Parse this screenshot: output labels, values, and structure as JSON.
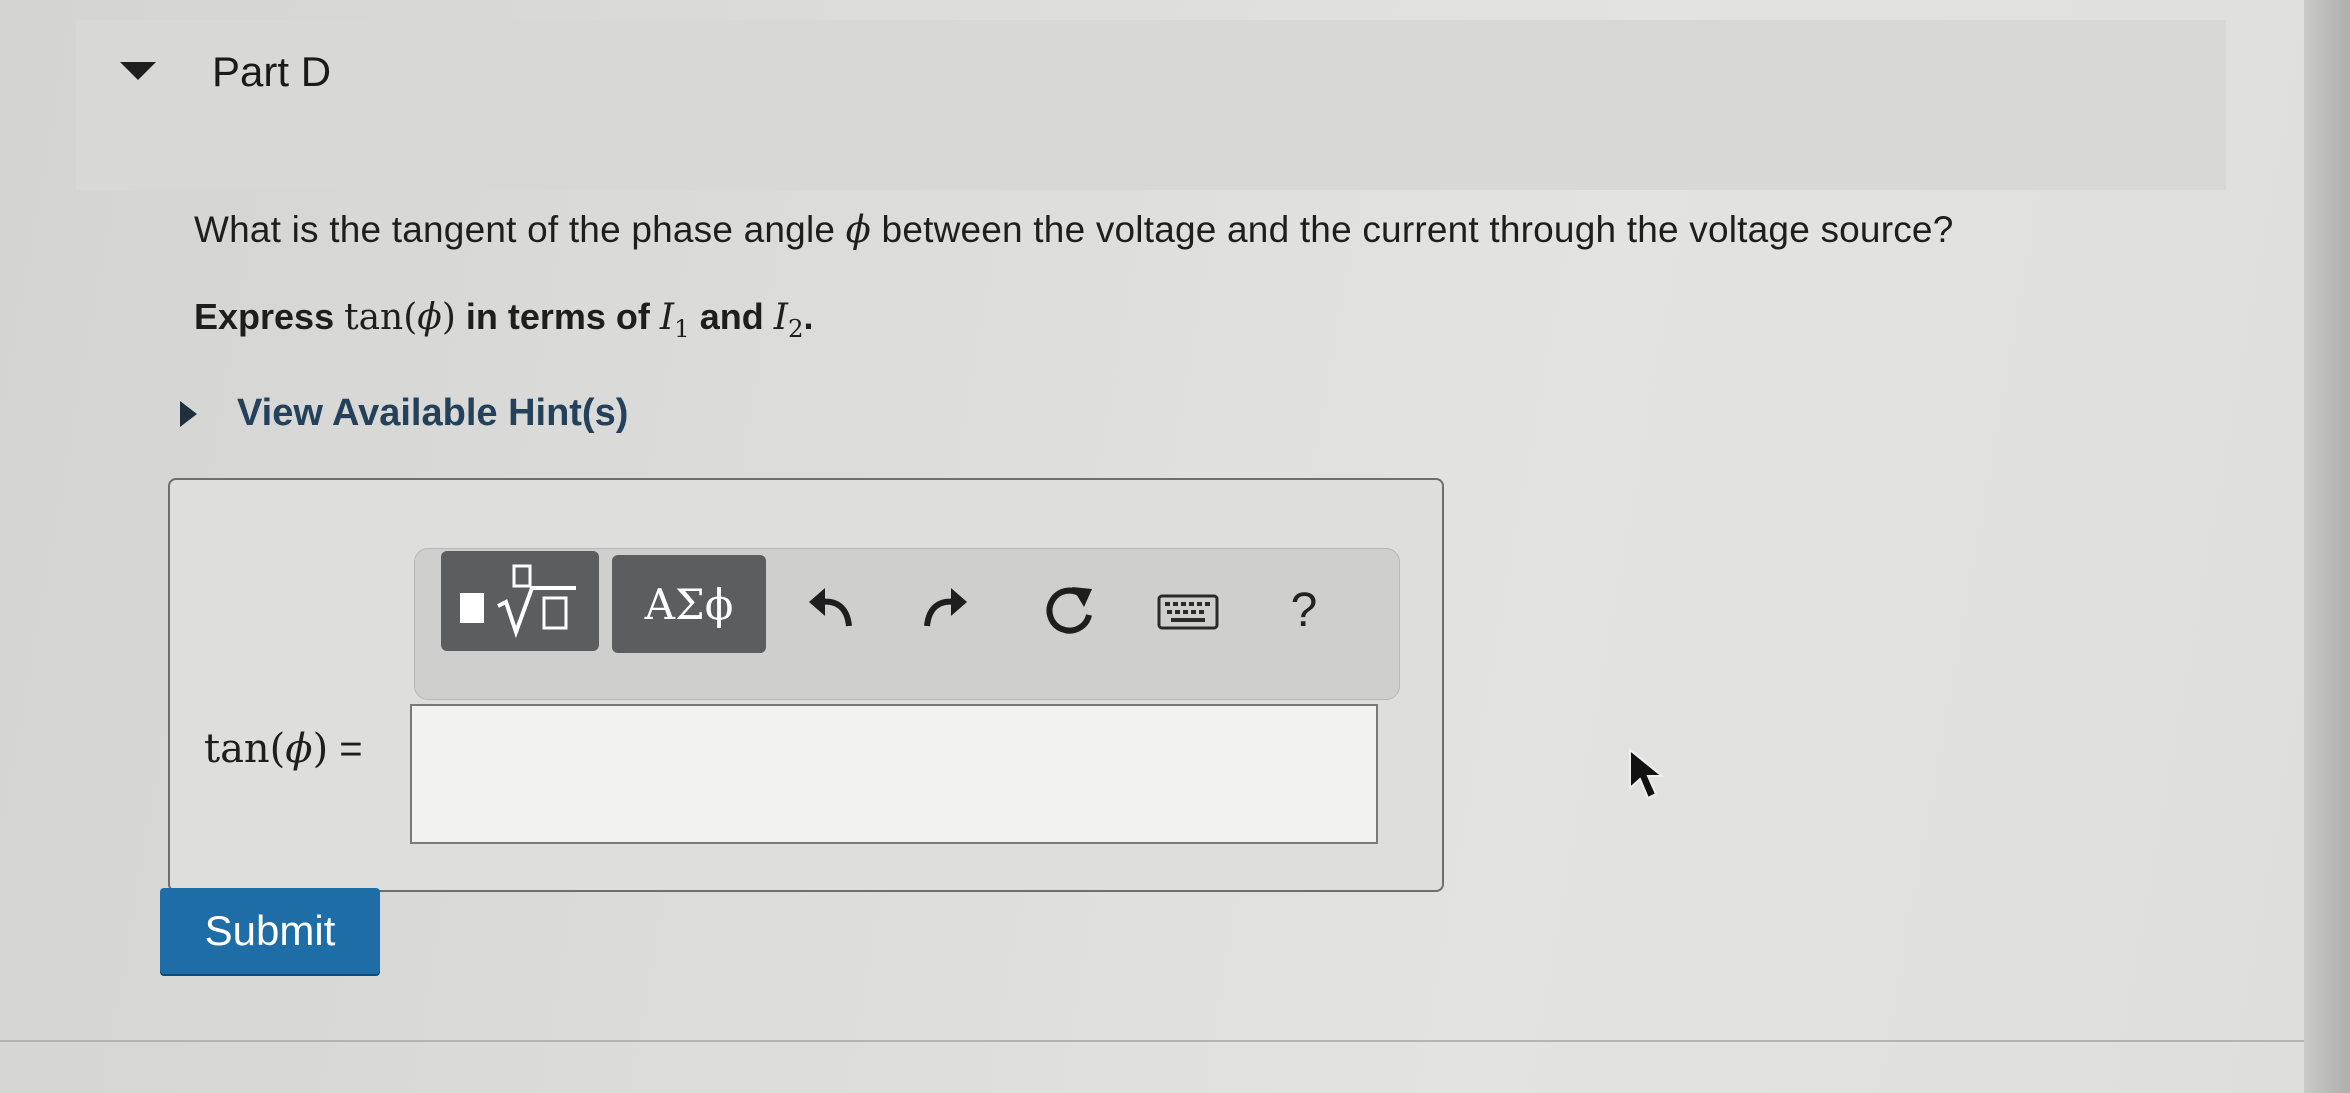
{
  "part": {
    "title": "Part D"
  },
  "question": {
    "text_before": "What is the tangent of the phase angle ",
    "phi": "ϕ",
    "text_after": " between the voltage and the current through the voltage source?"
  },
  "instruction": {
    "express": "Express ",
    "func": "tan(",
    "phi": "ϕ",
    "close": ")",
    "in_terms_of": " in terms of ",
    "i1_var": "I",
    "i1_sub": "1",
    "and": " and ",
    "i2_var": "I",
    "i2_sub": "2",
    "period": "."
  },
  "hints": {
    "label": "View Available Hint(s)"
  },
  "toolbar": {
    "symbols_label": "ΑΣϕ",
    "help_label": "?",
    "icons": [
      "templates-icon",
      "undo-icon",
      "redo-icon",
      "reset-icon",
      "keyboard-icon",
      "help-icon"
    ]
  },
  "answer": {
    "label_func": "tan(",
    "label_phi": "ϕ",
    "label_close": ")",
    "label_equals": " =",
    "value": ""
  },
  "submit": {
    "label": "Submit"
  },
  "colors": {
    "submit_bg": "#1f6da7",
    "hint_text": "#23415a",
    "toolbar_button": "#5b5d5f"
  }
}
